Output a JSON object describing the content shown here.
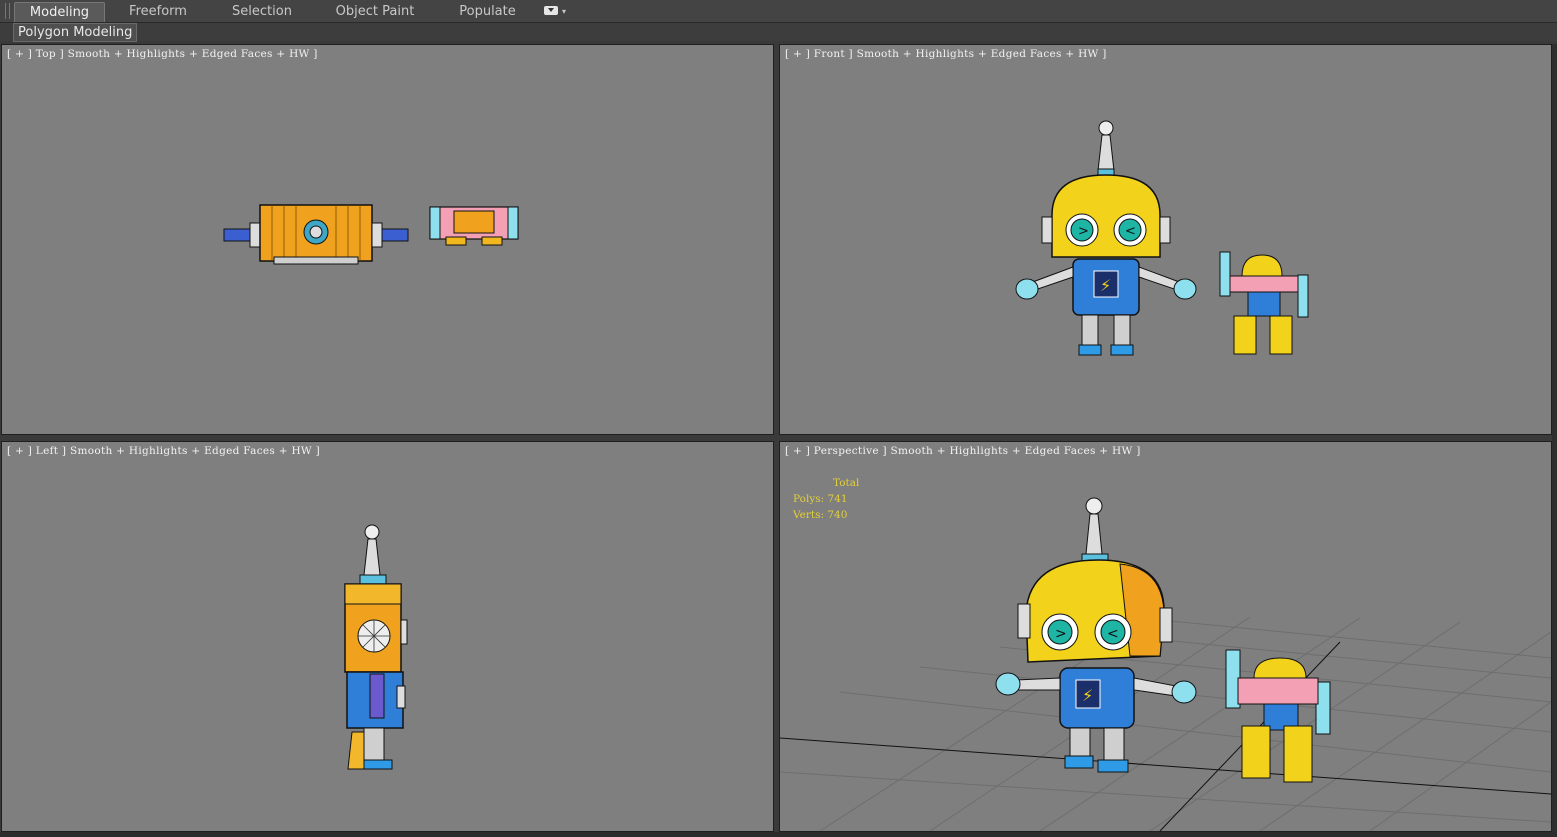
{
  "ribbon": {
    "tabs": [
      {
        "label": "Modeling",
        "active": true
      },
      {
        "label": "Freeform",
        "active": false
      },
      {
        "label": "Selection",
        "active": false
      },
      {
        "label": "Object Paint",
        "active": false
      },
      {
        "label": "Populate",
        "active": false
      }
    ],
    "panel_label": "Polygon Modeling",
    "dropdown_icon": "chevron-down-icon"
  },
  "viewports": {
    "top": {
      "label": "[ + ] Top ] Smooth + Highlights + Edged Faces + HW ]"
    },
    "front": {
      "label": "[ + ] Front ] Smooth + Highlights + Edged Faces + HW ]"
    },
    "left": {
      "label": "[ + ] Left ] Smooth + Highlights + Edged Faces + HW ]"
    },
    "perspective": {
      "label": "[ + ] Perspective ] Smooth + Highlights + Edged Faces + HW ]",
      "stats": {
        "total_label": "Total",
        "polys": "Polys: 741",
        "verts": "Verts: 740"
      }
    }
  },
  "colors": {
    "viewport_bg": "#7f7f7f",
    "robot_yellow": "#f2d21a",
    "robot_orange": "#f0a21e",
    "robot_blue": "#2f7fd8",
    "robot_cyan": "#8ee0ef",
    "robot_pink": "#f4a0b4",
    "eye_teal": "#1fb5a5",
    "stats_text": "#e2cf3a"
  }
}
